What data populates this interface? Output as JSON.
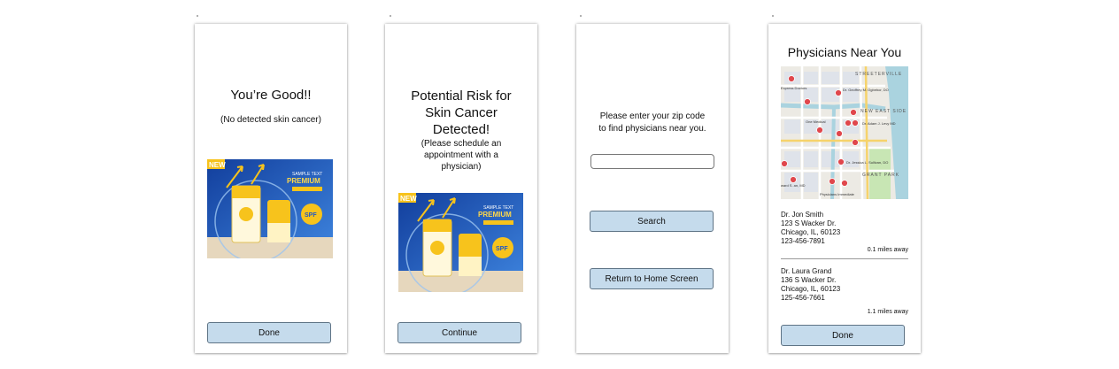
{
  "screens": [
    {
      "title": "You’re Good!!",
      "subtitle": "(No detected skin cancer)",
      "button": "Done"
    },
    {
      "title_lines": [
        "Potential Risk for",
        "Skin Cancer",
        "Detected!"
      ],
      "subtitle_lines": [
        "(Please schedule an",
        "appointment with a",
        "physician)"
      ],
      "button": "Continue"
    },
    {
      "prompt_lines": [
        "Please enter your zip code",
        "to find physicians near you."
      ],
      "zip_value": "",
      "search_button": "Search",
      "home_button": "Return to Home Screen"
    },
    {
      "title": "Physicians Near You",
      "map_labels": {
        "area1": "STREETERVILLE",
        "area2": "NEW EAST SIDE",
        "area3": "GRANT PARK",
        "pin1": "Dr. Geoffrey M. Ogbebor, DO",
        "pin2": "Dr. Adam J. Levy MD",
        "pin3": "Dr. Jessica L. Sullivan, DO",
        "pin4": "Physicians Immediate",
        "poi1": "Express Doctors",
        "poi2": "One Medical",
        "poi3": "ward S. an, MD"
      },
      "physicians": [
        {
          "name": "Dr. Jon Smith",
          "address": "123 S Wacker Dr.",
          "city": "Chicago, IL, 60123",
          "phone": "123-456-7891",
          "distance": "0.1 miles away"
        },
        {
          "name": "Dr. Laura Grand",
          "address": "136 S Wacker Dr.",
          "city": "Chicago, IL, 60123",
          "phone": "125-456-7661",
          "distance": "1.1 miles away"
        }
      ],
      "button": "Done"
    }
  ],
  "ad_text": {
    "new_badge": "NEW",
    "sample": "SAMPLE TEXT",
    "premium": "PREMIUM",
    "spf": "SPF"
  },
  "colors": {
    "button_fill": "#c5dbec",
    "button_border": "#5f7486",
    "map_water": "#aad3df",
    "map_pin": "#e0474c",
    "ad_blue": "#1e58c7",
    "ad_yellow": "#f7c31c"
  }
}
